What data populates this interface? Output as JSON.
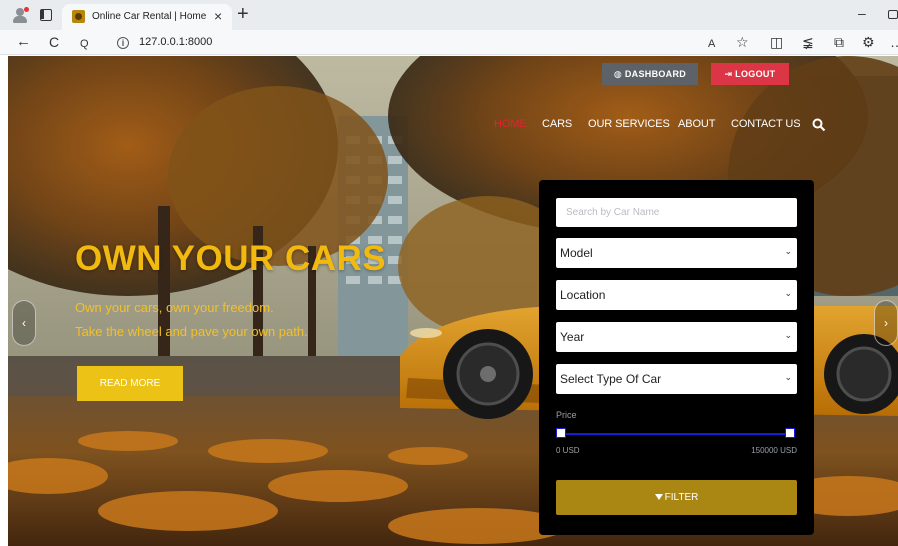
{
  "browser": {
    "tab_title": "Online Car Rental | Home",
    "tab_close": "×",
    "new_tab": "+",
    "url": "127.0.0.1:8000",
    "minimize": "–",
    "back": "←",
    "reload": "C",
    "search_glyph": "Q",
    "info_glyph": "i",
    "tool_icons": {
      "read_aloud": "A",
      "favorite": "☆",
      "split": "◫",
      "favorites": "≨",
      "collections": "⧉",
      "extensions": "⚙",
      "more": "…"
    }
  },
  "header": {
    "dashboard_label": "DASHBOARD",
    "logout_label": "LOGOUT",
    "nav": [
      "HOME",
      "CARS",
      "OUR SERVICES",
      "ABOUT",
      "CONTACT US"
    ],
    "active_nav": "HOME"
  },
  "hero": {
    "title": "OWN YOUR CARS",
    "line1": "Own your cars, own your freedom.",
    "line2": "Take the wheel and pave your own path.",
    "cta": "READ MORE",
    "prev": "‹",
    "next": "›"
  },
  "filter": {
    "search_placeholder": "Search by Car Name",
    "model": "Model",
    "location": "Location",
    "year": "Year",
    "type": "Select Type Of Car",
    "price_label": "Price",
    "min_price": "0 USD",
    "max_price": "150000 USD",
    "price_range_selected": [
      0,
      150000
    ],
    "filter_label": "FILTER",
    "chevron": "⌄"
  },
  "colors": {
    "accent_yellow": "#f2b90f",
    "logout_red": "#dc3545",
    "dashboard_gray": "#5d6168",
    "filter_gold": "#a98712",
    "slider_blue": "#1a1ad6",
    "nav_active": "#e0242f"
  }
}
